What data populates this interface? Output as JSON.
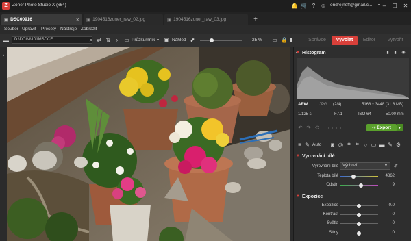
{
  "titlebar": {
    "title": "Zoner Photo Studio X (x64)",
    "account": "ondrejneff@gmail.c...",
    "account_chevron": "▾"
  },
  "tabs": [
    {
      "label": "DSC00916",
      "active": true
    },
    {
      "label": "1904516zoner_raw_02.jpg",
      "active": false
    },
    {
      "label": "1904516zoner_raw_03.jpg",
      "active": false
    }
  ],
  "menu": [
    "Soubor",
    "Upravit",
    "Presety",
    "Nástroje",
    "Zobrazit"
  ],
  "toolbar": {
    "path": "D:\\DCIM\\101MSDCF",
    "view_label": "Průzkumník",
    "view_chevron": "▾",
    "preview_label": "Náhled",
    "zoom": "25 %"
  },
  "modes": [
    "Správce",
    "Vyvolat",
    "Editor",
    "Vytvořit"
  ],
  "histogram": {
    "title": "Histogram"
  },
  "fileinfo": {
    "format_raw": "ARW",
    "format_jpg": "JPG",
    "count": "(2/4)",
    "dimensions": "5168 x 3448 (31.8 MB)",
    "shutter": "1/125 s",
    "aperture": "F7.1",
    "iso": "ISO 64",
    "focal": "50.00 mm"
  },
  "export_label": "Export",
  "auto_label": "Auto",
  "white_balance": {
    "title": "Vyrovnání bílé",
    "wb_label": "Vyrovnání bílé",
    "wb_value": "Výchozí",
    "temp_label": "Teplota bílé",
    "temp_value": "4862",
    "temp_pos": 0.38,
    "tint_label": "Odstín",
    "tint_value": "9",
    "tint_pos": 0.55
  },
  "exposure": {
    "title": "Expozice",
    "rows": [
      {
        "label": "Expozice",
        "value": "0.0",
        "pos": 0.5
      },
      {
        "label": "Kontrast",
        "value": "0",
        "pos": 0.5
      },
      {
        "label": "Světla",
        "value": "0",
        "pos": 0.5
      },
      {
        "label": "Stíny",
        "value": "0",
        "pos": 0.5
      }
    ]
  },
  "colors": {
    "accent": "#d9403a",
    "export": "#5aa02c"
  }
}
